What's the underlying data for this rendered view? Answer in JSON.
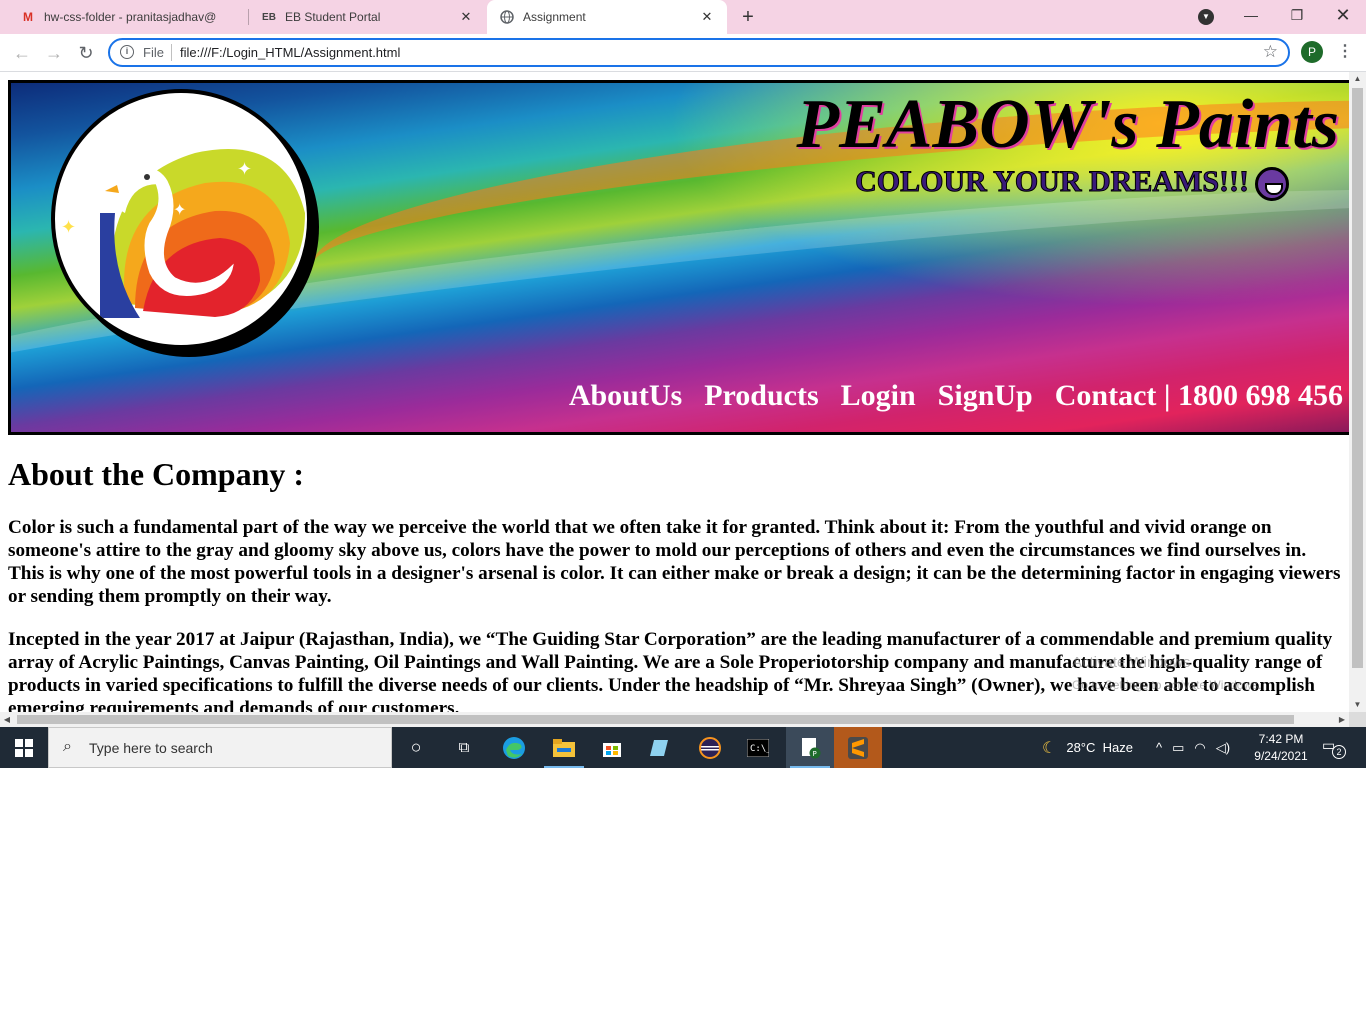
{
  "browser": {
    "tabs": [
      {
        "title": "hw-css-folder - pranitasjadhav@",
        "icon": "gmail-icon"
      },
      {
        "title": "EB Student Portal",
        "icon": "eb-icon"
      },
      {
        "title": "Assignment",
        "icon": "globe-icon",
        "active": true
      }
    ],
    "omnibox": {
      "scheme_label": "File",
      "url": "file:///F:/Login_HTML/Assignment.html"
    },
    "profile_initial": "P"
  },
  "page": {
    "brand_title": "PEABOW's Paints",
    "tagline": "COLOUR YOUR DREAMS!!!",
    "nav": [
      "AboutUs",
      "Products",
      "Login",
      "SignUp",
      "Contact | 1800 698 456"
    ],
    "about_heading": "About the Company :",
    "paragraph1": "Color is such a fundamental part of the way we perceive the world that we often take it for granted. Think about it: From the youthful and vivid orange on someone's attire to the gray and gloomy sky above us, colors have the power to mold our perceptions of others and even the circumstances we find ourselves in. This is why one of the most powerful tools in a designer's arsenal is color. It can either make or break a design; it can be the determining factor in engaging viewers or sending them promptly on their way.",
    "paragraph2": "Incepted in the year 2017 at Jaipur (Rajasthan, India), we “The Guiding Star Corporation” are the leading manufacturer of a commendable and premium quality array of Acrylic Paintings, Canvas Painting, Oil Paintings and Wall Painting. We are a Sole Properiotorship company and manufacture the high-quality range of products in varied specifications to fulfill the diverse needs of our clients. Under the headship of “Mr. Shreyaa Singh” (Owner), we have been able to accomplish emerging requirements and demands of our customers.",
    "watermark_line1": "Activate Windows",
    "watermark_line2": "Go to Settings to activate Windows."
  },
  "taskbar": {
    "search_placeholder": "Type here to search",
    "weather": "28°C  Haze",
    "time": "7:42 PM",
    "date": "9/24/2021",
    "notification_count": "2"
  },
  "colors": {
    "tabstrip": "#f5d3e4",
    "omnibox_focus": "#1a73e8",
    "taskbar": "#1f2a36",
    "profile": "#1e6b2a"
  }
}
